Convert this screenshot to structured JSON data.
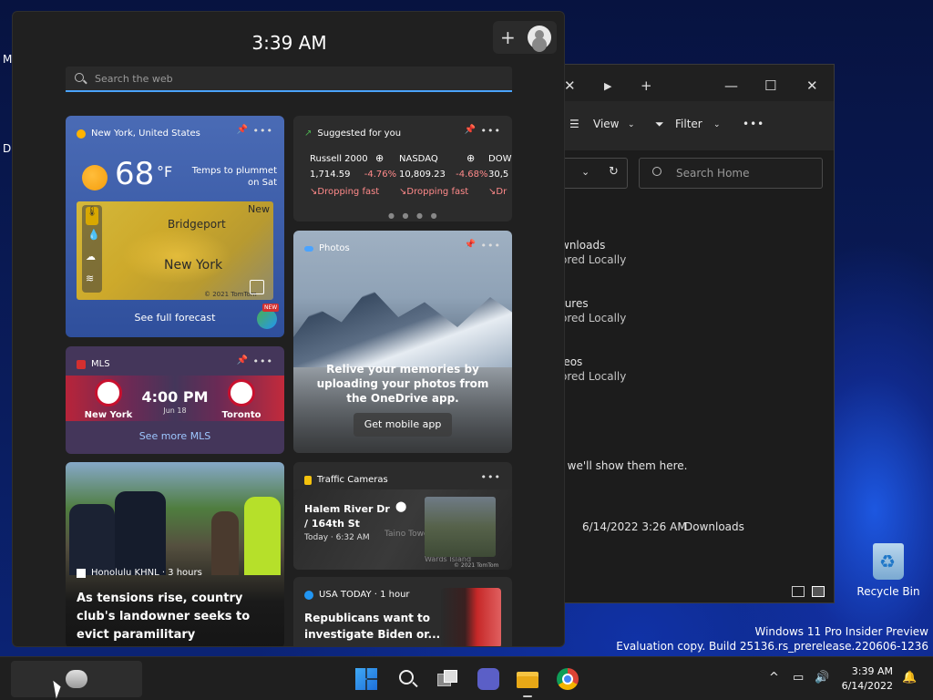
{
  "desktop": {
    "side_letters": [
      "M",
      "D"
    ],
    "recycle_bin_label": "Recycle Bin",
    "watermark_line1": "Windows 11 Pro Insider Preview",
    "watermark_line2": "Evaluation copy. Build 25136.rs_prerelease.220606-1236"
  },
  "explorer": {
    "tab_close": "✕",
    "new_tab": "+",
    "toolbar_view": "View",
    "toolbar_filter": "Filter",
    "toolbar_more": "•••",
    "search_placeholder": "Search Home",
    "items": [
      {
        "name": "wnloads",
        "status": "ored Locally"
      },
      {
        "name": "tures",
        "status": "ored Locally"
      },
      {
        "name": "leos",
        "status": "ored Locally"
      }
    ],
    "empty_message": ", we'll show them here.",
    "recent_date": "6/14/2022 3:26 AM",
    "recent_location": "Downloads"
  },
  "widgets": {
    "time": "3:39 AM",
    "search_placeholder": "Search the web",
    "weather": {
      "location": "New York, United States",
      "temperature": "68",
      "unit": "°F",
      "note": "Temps to plummet on Sat",
      "map_cities": [
        "Bridgeport",
        "New York",
        "New"
      ],
      "map_credit": "© 2021 TomTom",
      "forecast_link": "See full forecast",
      "badge": "NEW"
    },
    "stocks": {
      "title": "Suggested for you",
      "items": [
        {
          "name": "Russell 2000",
          "value": "1,714.59",
          "change": "-4.76%",
          "trend": "Dropping fast"
        },
        {
          "name": "NASDAQ",
          "value": "10,809.23",
          "change": "-4.68%",
          "trend": "Dropping fast"
        },
        {
          "name": "DOW",
          "value": "30,5",
          "change": "",
          "trend": "Dr"
        }
      ]
    },
    "photos": {
      "title": "Photos",
      "message": "Relive your memories by uploading your photos from the OneDrive app.",
      "button": "Get mobile app"
    },
    "mls": {
      "title": "MLS",
      "home_team": "New York",
      "away_team": "Toronto",
      "time": "4:00 PM",
      "date": "Jun 18",
      "more_link": "See more MLS"
    },
    "news": {
      "source": "Honolulu KHNL · 3 hours",
      "headline": "As tensions rise, country club's landowner seeks to evict paramilitary sovereignty group"
    },
    "traffic": {
      "title": "Traffic Cameras",
      "location": "Halem River Dr / 164th St",
      "time": "Today · 6:32 AM",
      "map_label1": "Taino Towers",
      "map_label2": "Wards Island",
      "credit": "© 2021 TomTom"
    },
    "usatoday": {
      "source": "USA TODAY · 1 hour",
      "headline": "Republicans want to investigate Biden or..."
    }
  },
  "taskbar": {
    "clock_time": "3:39 AM",
    "clock_date": "6/14/2022"
  },
  "colors": {
    "accent": "#4aa3ff",
    "negative": "#ff8a8a",
    "weather_card": "#3d5ea8",
    "mls_card": "#44365a"
  }
}
